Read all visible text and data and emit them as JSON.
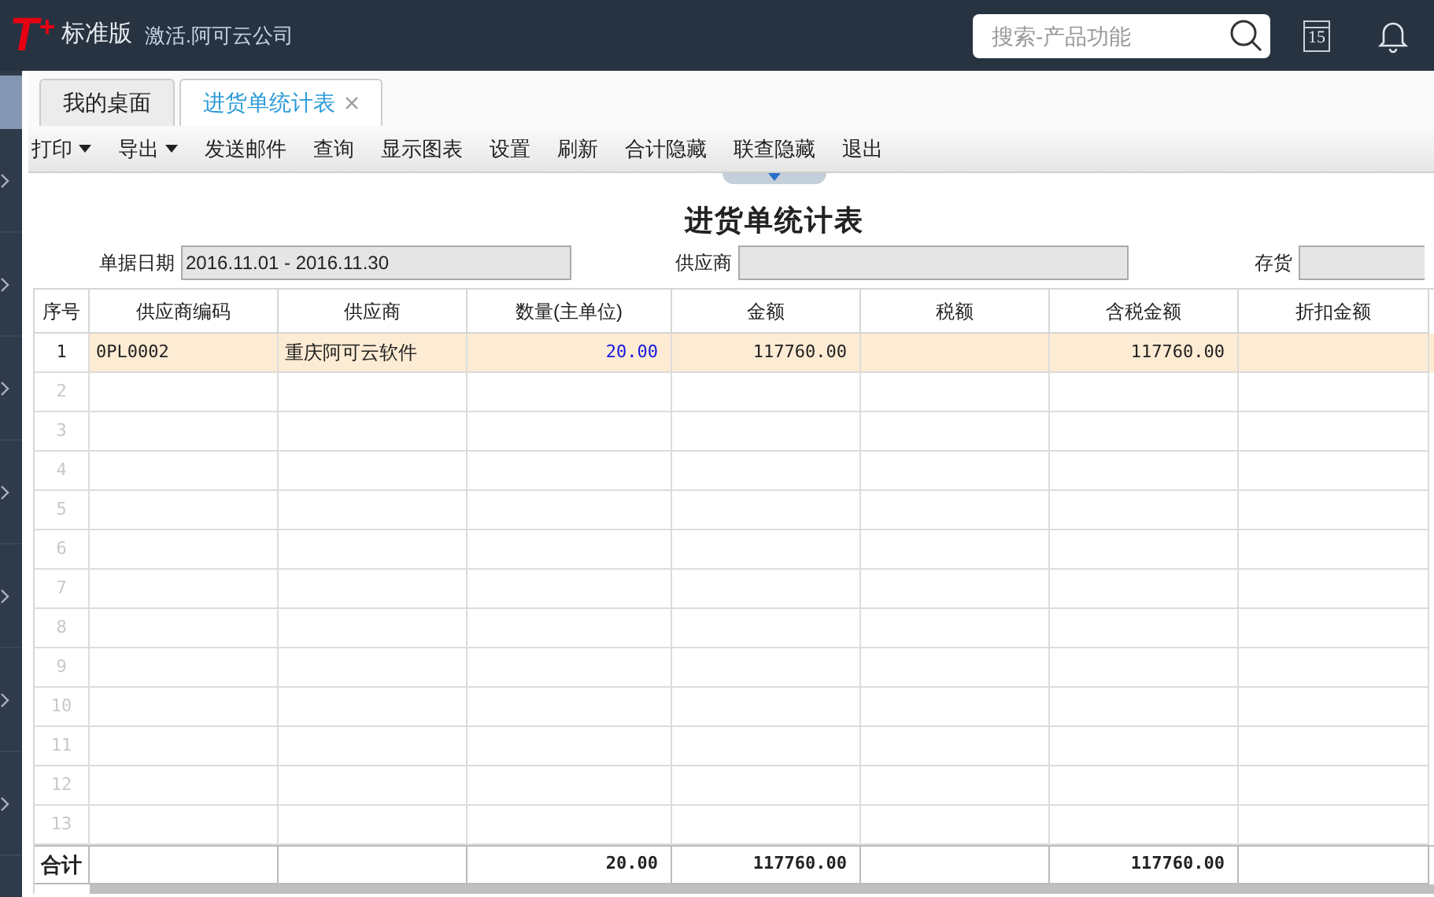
{
  "header": {
    "logo": "T",
    "logo_mark": "+",
    "edition": "标准版",
    "company": "激活.阿可云公司",
    "search": {
      "placeholder": "搜索-产品功能"
    },
    "calendar_day": "15"
  },
  "tabs": [
    {
      "label": "我的桌面",
      "selected": false,
      "closable": false
    },
    {
      "label": "进货单统计表",
      "selected": true,
      "closable": true
    }
  ],
  "toolbar": [
    {
      "label": "打印",
      "dropdown": true
    },
    {
      "label": "导出",
      "dropdown": true
    },
    {
      "label": "发送邮件",
      "dropdown": false
    },
    {
      "label": "查询",
      "dropdown": false
    },
    {
      "label": "显示图表",
      "dropdown": false
    },
    {
      "label": "设置",
      "dropdown": false
    },
    {
      "label": "刷新",
      "dropdown": false
    },
    {
      "label": "合计隐藏",
      "dropdown": false
    },
    {
      "label": "联查隐藏",
      "dropdown": false
    },
    {
      "label": "退出",
      "dropdown": false
    }
  ],
  "report": {
    "title": "进货单统计表",
    "filters": [
      {
        "label": "单据日期",
        "value": "2016.11.01 - 2016.11.30"
      },
      {
        "label": "供应商"
      },
      {
        "label": "存货"
      }
    ],
    "table": {
      "columns": [
        "序号",
        "供应商编码",
        "供应商",
        "数量(主单位)",
        "金额",
        "税额",
        "含税金额",
        "折扣金额"
      ],
      "rows": [
        {
          "selected": true,
          "cells": [
            "1",
            "0PL0002",
            "重庆阿可云软件",
            "20.00",
            "117760.00",
            null,
            "117760.00",
            null
          ]
        },
        {
          "selected": false,
          "cells": [
            "2",
            null,
            null,
            null,
            null,
            null,
            null,
            null
          ]
        },
        {
          "selected": false,
          "cells": [
            "3",
            null,
            null,
            null,
            null,
            null,
            null,
            null
          ]
        },
        {
          "selected": false,
          "cells": [
            "4",
            null,
            null,
            null,
            null,
            null,
            null,
            null
          ]
        },
        {
          "selected": false,
          "cells": [
            "5",
            null,
            null,
            null,
            null,
            null,
            null,
            null
          ]
        },
        {
          "selected": false,
          "cells": [
            "6",
            null,
            null,
            null,
            null,
            null,
            null,
            null
          ]
        },
        {
          "selected": false,
          "cells": [
            "7",
            null,
            null,
            null,
            null,
            null,
            null,
            null
          ]
        },
        {
          "selected": false,
          "cells": [
            "8",
            null,
            null,
            null,
            null,
            null,
            null,
            null
          ]
        },
        {
          "selected": false,
          "cells": [
            "9",
            null,
            null,
            null,
            null,
            null,
            null,
            null
          ]
        },
        {
          "selected": false,
          "cells": [
            "10",
            null,
            null,
            null,
            null,
            null,
            null,
            null
          ]
        },
        {
          "selected": false,
          "cells": [
            "11",
            null,
            null,
            null,
            null,
            null,
            null,
            null
          ]
        },
        {
          "selected": false,
          "cells": [
            "12",
            null,
            null,
            null,
            null,
            null,
            null,
            null
          ]
        },
        {
          "selected": false,
          "cells": [
            "13",
            null,
            null,
            null,
            null,
            null,
            null,
            null
          ]
        }
      ],
      "total": {
        "label": "合计",
        "quantity": "20.00",
        "amount": "117760.00",
        "amount_with_tax": "117760.00"
      }
    }
  }
}
